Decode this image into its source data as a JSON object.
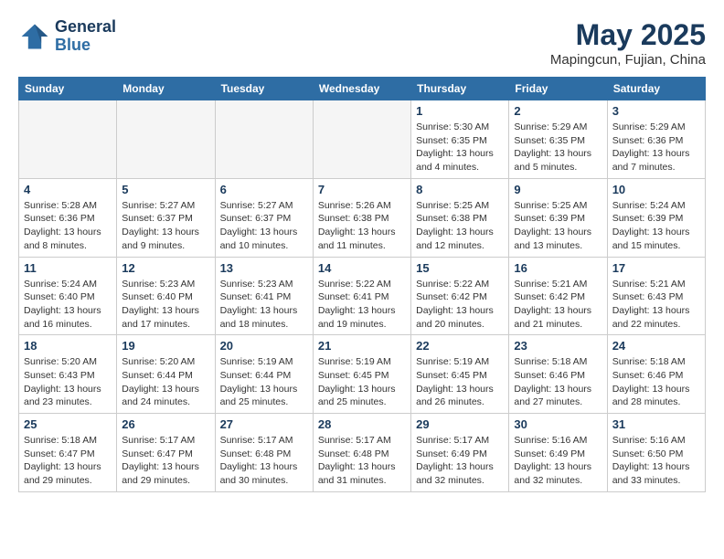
{
  "header": {
    "logo_line1": "General",
    "logo_line2": "Blue",
    "month_title": "May 2025",
    "location": "Mapingcun, Fujian, China"
  },
  "days_of_week": [
    "Sunday",
    "Monday",
    "Tuesday",
    "Wednesday",
    "Thursday",
    "Friday",
    "Saturday"
  ],
  "weeks": [
    [
      {
        "day": "",
        "info": ""
      },
      {
        "day": "",
        "info": ""
      },
      {
        "day": "",
        "info": ""
      },
      {
        "day": "",
        "info": ""
      },
      {
        "day": "1",
        "info": "Sunrise: 5:30 AM\nSunset: 6:35 PM\nDaylight: 13 hours\nand 4 minutes."
      },
      {
        "day": "2",
        "info": "Sunrise: 5:29 AM\nSunset: 6:35 PM\nDaylight: 13 hours\nand 5 minutes."
      },
      {
        "day": "3",
        "info": "Sunrise: 5:29 AM\nSunset: 6:36 PM\nDaylight: 13 hours\nand 7 minutes."
      }
    ],
    [
      {
        "day": "4",
        "info": "Sunrise: 5:28 AM\nSunset: 6:36 PM\nDaylight: 13 hours\nand 8 minutes."
      },
      {
        "day": "5",
        "info": "Sunrise: 5:27 AM\nSunset: 6:37 PM\nDaylight: 13 hours\nand 9 minutes."
      },
      {
        "day": "6",
        "info": "Sunrise: 5:27 AM\nSunset: 6:37 PM\nDaylight: 13 hours\nand 10 minutes."
      },
      {
        "day": "7",
        "info": "Sunrise: 5:26 AM\nSunset: 6:38 PM\nDaylight: 13 hours\nand 11 minutes."
      },
      {
        "day": "8",
        "info": "Sunrise: 5:25 AM\nSunset: 6:38 PM\nDaylight: 13 hours\nand 12 minutes."
      },
      {
        "day": "9",
        "info": "Sunrise: 5:25 AM\nSunset: 6:39 PM\nDaylight: 13 hours\nand 13 minutes."
      },
      {
        "day": "10",
        "info": "Sunrise: 5:24 AM\nSunset: 6:39 PM\nDaylight: 13 hours\nand 15 minutes."
      }
    ],
    [
      {
        "day": "11",
        "info": "Sunrise: 5:24 AM\nSunset: 6:40 PM\nDaylight: 13 hours\nand 16 minutes."
      },
      {
        "day": "12",
        "info": "Sunrise: 5:23 AM\nSunset: 6:40 PM\nDaylight: 13 hours\nand 17 minutes."
      },
      {
        "day": "13",
        "info": "Sunrise: 5:23 AM\nSunset: 6:41 PM\nDaylight: 13 hours\nand 18 minutes."
      },
      {
        "day": "14",
        "info": "Sunrise: 5:22 AM\nSunset: 6:41 PM\nDaylight: 13 hours\nand 19 minutes."
      },
      {
        "day": "15",
        "info": "Sunrise: 5:22 AM\nSunset: 6:42 PM\nDaylight: 13 hours\nand 20 minutes."
      },
      {
        "day": "16",
        "info": "Sunrise: 5:21 AM\nSunset: 6:42 PM\nDaylight: 13 hours\nand 21 minutes."
      },
      {
        "day": "17",
        "info": "Sunrise: 5:21 AM\nSunset: 6:43 PM\nDaylight: 13 hours\nand 22 minutes."
      }
    ],
    [
      {
        "day": "18",
        "info": "Sunrise: 5:20 AM\nSunset: 6:43 PM\nDaylight: 13 hours\nand 23 minutes."
      },
      {
        "day": "19",
        "info": "Sunrise: 5:20 AM\nSunset: 6:44 PM\nDaylight: 13 hours\nand 24 minutes."
      },
      {
        "day": "20",
        "info": "Sunrise: 5:19 AM\nSunset: 6:44 PM\nDaylight: 13 hours\nand 25 minutes."
      },
      {
        "day": "21",
        "info": "Sunrise: 5:19 AM\nSunset: 6:45 PM\nDaylight: 13 hours\nand 25 minutes."
      },
      {
        "day": "22",
        "info": "Sunrise: 5:19 AM\nSunset: 6:45 PM\nDaylight: 13 hours\nand 26 minutes."
      },
      {
        "day": "23",
        "info": "Sunrise: 5:18 AM\nSunset: 6:46 PM\nDaylight: 13 hours\nand 27 minutes."
      },
      {
        "day": "24",
        "info": "Sunrise: 5:18 AM\nSunset: 6:46 PM\nDaylight: 13 hours\nand 28 minutes."
      }
    ],
    [
      {
        "day": "25",
        "info": "Sunrise: 5:18 AM\nSunset: 6:47 PM\nDaylight: 13 hours\nand 29 minutes."
      },
      {
        "day": "26",
        "info": "Sunrise: 5:17 AM\nSunset: 6:47 PM\nDaylight: 13 hours\nand 29 minutes."
      },
      {
        "day": "27",
        "info": "Sunrise: 5:17 AM\nSunset: 6:48 PM\nDaylight: 13 hours\nand 30 minutes."
      },
      {
        "day": "28",
        "info": "Sunrise: 5:17 AM\nSunset: 6:48 PM\nDaylight: 13 hours\nand 31 minutes."
      },
      {
        "day": "29",
        "info": "Sunrise: 5:17 AM\nSunset: 6:49 PM\nDaylight: 13 hours\nand 32 minutes."
      },
      {
        "day": "30",
        "info": "Sunrise: 5:16 AM\nSunset: 6:49 PM\nDaylight: 13 hours\nand 32 minutes."
      },
      {
        "day": "31",
        "info": "Sunrise: 5:16 AM\nSunset: 6:50 PM\nDaylight: 13 hours\nand 33 minutes."
      }
    ]
  ]
}
